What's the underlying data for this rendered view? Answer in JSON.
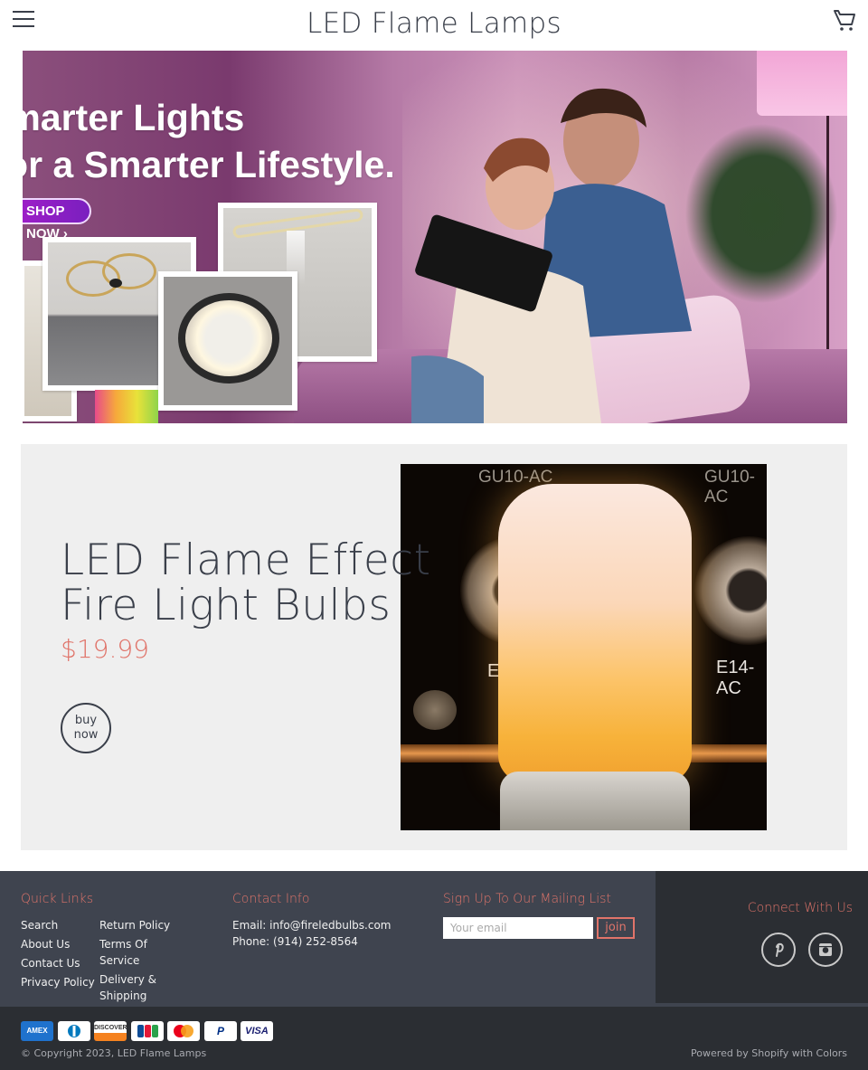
{
  "header": {
    "site_title": "LED Flame Lamps",
    "menu_icon": "hamburger-menu-icon",
    "cart_icon": "shopping-cart-icon"
  },
  "hero": {
    "headline_line1": "Smarter Lights",
    "headline_line2": "For a Smarter Lifestyle.",
    "cta_label": "SHOP NOW",
    "cta_icon": "chevron-right-icon",
    "image_description": "Couple on sofa with tablet in pink-lit living room, ceiling light product collage"
  },
  "product": {
    "title_line1": "LED Flame Effect",
    "title_line2": "Fire Light Bulbs",
    "price": "$19.99",
    "buy_label_line1": "buy",
    "buy_label_line2": "now",
    "photo_labels": [
      "GU10-AC",
      "GU10-AC",
      "E14-AC",
      "E"
    ]
  },
  "footer": {
    "quick_links": {
      "heading": "Quick Links",
      "col1": [
        "Search",
        "About Us",
        "Contact Us",
        "Privacy Policy"
      ],
      "col2": [
        "Return Policy",
        "Terms Of Service",
        "Delivery & Shipping"
      ]
    },
    "contact": {
      "heading": "Contact Info",
      "email": "Email: info@fireledbulbs.com",
      "phone": "Phone: (914) 252-8564"
    },
    "mailing": {
      "heading": "Sign Up To Our Mailing List",
      "email_placeholder": "Your email",
      "email_value": "",
      "join_label": "join"
    },
    "social": {
      "heading": "Connect With Us",
      "icons": [
        "pinterest-icon",
        "instagram-icon"
      ]
    },
    "payment_methods": [
      "AMEX",
      "Diners Club",
      "DISCOVER",
      "JCB",
      "Mastercard",
      "PayPal",
      "VISA"
    ],
    "copyright": "© Copyright 2023, LED Flame Lamps",
    "powered_by": "Powered by Shopify with Colors"
  },
  "colors": {
    "accent": "#e0746a",
    "text_dark": "#3a3f4a",
    "footer_bg": "#3f444f",
    "footer_dark_bg": "#2b2e33",
    "product_bg": "#efefef"
  }
}
